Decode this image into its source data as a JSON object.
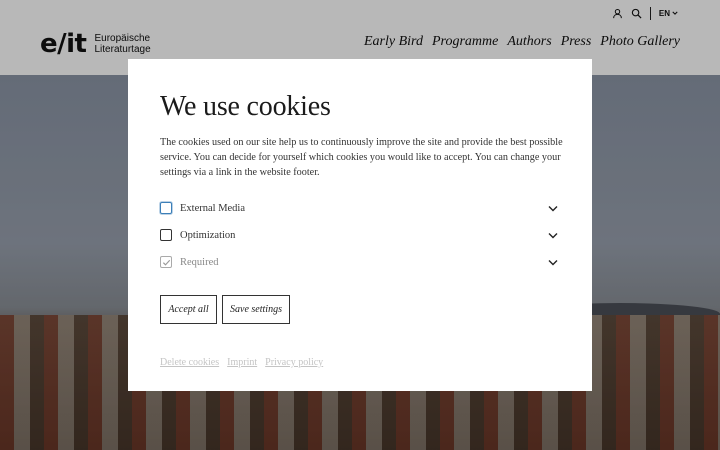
{
  "header": {
    "logo_mark": "e/it",
    "logo_line1": "Europäische",
    "logo_line2": "Literaturtage",
    "language": "EN",
    "utility_icons": [
      "user-icon",
      "search-icon"
    ],
    "nav": [
      "Early Bird",
      "Programme",
      "Authors",
      "Press",
      "Photo Gallery"
    ]
  },
  "cookie_modal": {
    "title": "We use cookies",
    "description": "The cookies used on our site help us to continuously improve the site and provide the best possible service. You can decide for yourself which cookies you would like to accept. You can change your settings via a link in the website footer.",
    "options": [
      {
        "label": "External Media",
        "checked": false,
        "disabled": false
      },
      {
        "label": "Optimization",
        "checked": false,
        "disabled": false
      },
      {
        "label": "Required",
        "checked": true,
        "disabled": true
      }
    ],
    "accept_all_label": "Accept all",
    "save_settings_label": "Save settings",
    "links": [
      "Delete cookies",
      "Imprint",
      "Privacy policy"
    ]
  },
  "colors": {
    "focus_ring": "#3c7fb8",
    "overlay": "rgba(0,0,0,0.28)",
    "link_muted": "#c4c4c4"
  }
}
